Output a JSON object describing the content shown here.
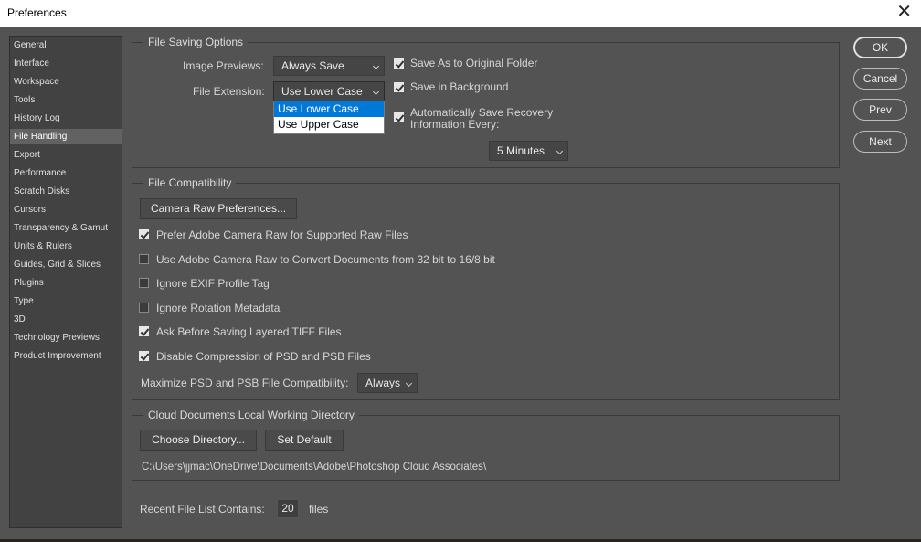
{
  "window": {
    "title": "Preferences"
  },
  "sidebar": {
    "items": [
      {
        "label": "General",
        "active": false
      },
      {
        "label": "Interface",
        "active": false
      },
      {
        "label": "Workspace",
        "active": false
      },
      {
        "label": "Tools",
        "active": false
      },
      {
        "label": "History Log",
        "active": false
      },
      {
        "label": "File Handling",
        "active": true
      },
      {
        "label": "Export",
        "active": false
      },
      {
        "label": "Performance",
        "active": false
      },
      {
        "label": "Scratch Disks",
        "active": false
      },
      {
        "label": "Cursors",
        "active": false
      },
      {
        "label": "Transparency & Gamut",
        "active": false
      },
      {
        "label": "Units & Rulers",
        "active": false
      },
      {
        "label": "Guides, Grid & Slices",
        "active": false
      },
      {
        "label": "Plugins",
        "active": false
      },
      {
        "label": "Type",
        "active": false
      },
      {
        "label": "3D",
        "active": false
      },
      {
        "label": "Technology Previews",
        "active": false
      },
      {
        "label": "Product Improvement",
        "active": false
      }
    ]
  },
  "file_saving": {
    "title": "File Saving Options",
    "image_previews_label": "Image Previews:",
    "image_previews_value": "Always Save",
    "file_extension_label": "File Extension:",
    "file_extension_value": "Use Lower Case",
    "file_extension_options": [
      "Use Lower Case",
      "Use Upper Case"
    ],
    "save_as_original": {
      "label": "Save As to Original Folder",
      "checked": true
    },
    "save_in_background": {
      "label": "Save in Background",
      "checked": true
    },
    "auto_save": {
      "label_line1": "Automatically Save Recovery",
      "label_line2": "Information Every:",
      "checked": true
    },
    "auto_save_interval": "5 Minutes"
  },
  "file_compat": {
    "title": "File Compatibility",
    "camera_raw_button": "Camera Raw Preferences...",
    "options": [
      {
        "label": "Prefer Adobe Camera Raw for Supported Raw Files",
        "checked": true
      },
      {
        "label": "Use Adobe Camera Raw to Convert Documents from 32 bit to 16/8 bit",
        "checked": false
      },
      {
        "label": "Ignore EXIF Profile Tag",
        "checked": false
      },
      {
        "label": "Ignore Rotation Metadata",
        "checked": false
      },
      {
        "label": "Ask Before Saving Layered TIFF Files",
        "checked": true
      },
      {
        "label": "Disable Compression of PSD and PSB Files",
        "checked": true
      }
    ],
    "maximize_label": "Maximize PSD and PSB File Compatibility:",
    "maximize_value": "Always"
  },
  "cloud": {
    "title": "Cloud Documents Local Working Directory",
    "choose_button": "Choose Directory...",
    "default_button": "Set Default",
    "path": "C:\\Users\\jjmac\\OneDrive\\Documents\\Adobe\\Photoshop Cloud Associates\\"
  },
  "recent": {
    "label": "Recent File List Contains:",
    "value": "20",
    "suffix": "files"
  },
  "buttons": {
    "ok": "OK",
    "cancel": "Cancel",
    "prev": "Prev",
    "next": "Next"
  },
  "icons": {
    "close": "close-icon",
    "chevron": "chevron-down-icon",
    "check": "checkmark-icon"
  }
}
